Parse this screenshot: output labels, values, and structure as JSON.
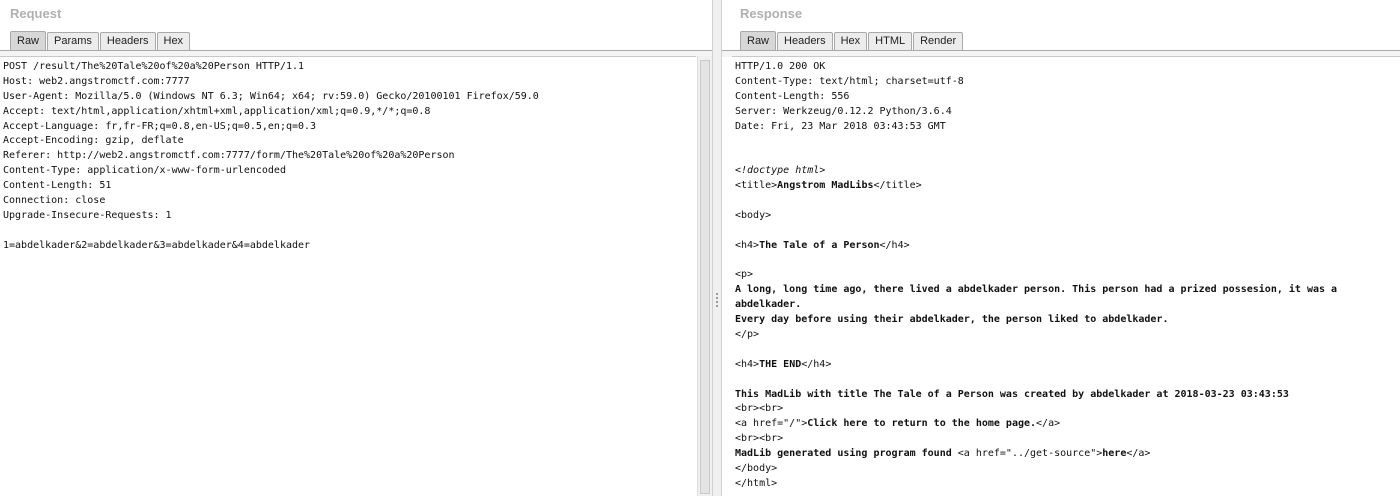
{
  "request": {
    "title": "Request",
    "tabs": [
      "Raw",
      "Params",
      "Headers",
      "Hex"
    ],
    "active_tab": "Raw",
    "lines": [
      "POST /result/The%20Tale%20of%20a%20Person HTTP/1.1",
      "Host: web2.angstromctf.com:7777",
      "User-Agent: Mozilla/5.0 (Windows NT 6.3; Win64; x64; rv:59.0) Gecko/20100101 Firefox/59.0",
      "Accept: text/html,application/xhtml+xml,application/xml;q=0.9,*/*;q=0.8",
      "Accept-Language: fr,fr-FR;q=0.8,en-US;q=0.5,en;q=0.3",
      "Accept-Encoding: gzip, deflate",
      "Referer: http://web2.angstromctf.com:7777/form/The%20Tale%20of%20a%20Person",
      "Content-Type: application/x-www-form-urlencoded",
      "Content-Length: 51",
      "Connection: close",
      "Upgrade-Insecure-Requests: 1",
      "",
      "1=abdelkader&2=abdelkader&3=abdelkader&4=abdelkader"
    ]
  },
  "response": {
    "title": "Response",
    "tabs": [
      "Raw",
      "Headers",
      "Hex",
      "HTML",
      "Render"
    ],
    "active_tab": "Raw",
    "lines": [
      {
        "parts": [
          {
            "t": "HTTP/1.0 200 OK"
          }
        ]
      },
      {
        "parts": [
          {
            "t": "Content-Type: text/html; charset=utf-8"
          }
        ]
      },
      {
        "parts": [
          {
            "t": "Content-Length: 556"
          }
        ]
      },
      {
        "parts": [
          {
            "t": "Server: Werkzeug/0.12.2 Python/3.6.4"
          }
        ]
      },
      {
        "parts": [
          {
            "t": "Date: Fri, 23 Mar 2018 03:43:53 GMT"
          }
        ]
      },
      {
        "parts": []
      },
      {
        "parts": []
      },
      {
        "parts": [
          {
            "t": "<!doctype html>",
            "s": "i"
          }
        ]
      },
      {
        "parts": [
          {
            "t": "<title>"
          },
          {
            "t": "Angstrom MadLibs",
            "s": "b"
          },
          {
            "t": "</title>"
          }
        ]
      },
      {
        "parts": []
      },
      {
        "parts": [
          {
            "t": "<body>"
          }
        ]
      },
      {
        "parts": []
      },
      {
        "parts": [
          {
            "t": "<h4>"
          },
          {
            "t": "The Tale of a Person",
            "s": "b"
          },
          {
            "t": "</h4>"
          }
        ]
      },
      {
        "parts": []
      },
      {
        "parts": [
          {
            "t": "<p>"
          }
        ]
      },
      {
        "parts": [
          {
            "t": "A long, long time ago, there lived a abdelkader person. This person had a prized possesion, it was a",
            "s": "b"
          }
        ]
      },
      {
        "parts": [
          {
            "t": "abdelkader.",
            "s": "b"
          }
        ]
      },
      {
        "parts": [
          {
            "t": "Every day before using their abdelkader, the person liked to abdelkader.",
            "s": "b"
          }
        ]
      },
      {
        "parts": [
          {
            "t": "</p>"
          }
        ]
      },
      {
        "parts": []
      },
      {
        "parts": [
          {
            "t": "<h4>"
          },
          {
            "t": "THE END",
            "s": "b"
          },
          {
            "t": "</h4>"
          }
        ]
      },
      {
        "parts": []
      },
      {
        "parts": [
          {
            "t": "This MadLib with title The Tale of a Person was created by abdelkader at 2018-03-23 03:43:53",
            "s": "b"
          }
        ]
      },
      {
        "parts": [
          {
            "t": "<br><br>"
          }
        ]
      },
      {
        "parts": [
          {
            "t": "<a href=\"/\">"
          },
          {
            "t": "Click here to return to the home page.",
            "s": "b"
          },
          {
            "t": "</a>"
          }
        ]
      },
      {
        "parts": [
          {
            "t": "<br><br>"
          }
        ]
      },
      {
        "parts": [
          {
            "t": "MadLib generated using program found ",
            "s": "b"
          },
          {
            "t": "<a href=\"../get-source\">"
          },
          {
            "t": "here",
            "s": "b"
          },
          {
            "t": "</a>"
          }
        ]
      },
      {
        "parts": [
          {
            "t": "</body>"
          }
        ]
      },
      {
        "parts": [
          {
            "t": "</html>"
          }
        ]
      }
    ]
  }
}
